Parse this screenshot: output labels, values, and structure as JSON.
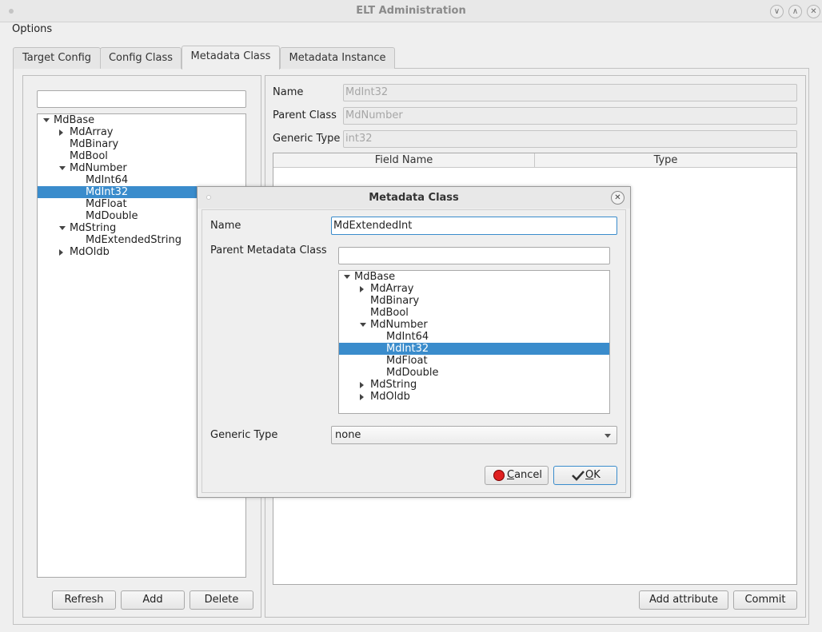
{
  "window": {
    "title": "ELT Administration",
    "controls": {
      "minimize": "∨",
      "maximize": "∧",
      "close": "✕"
    }
  },
  "menu": {
    "items": [
      "Options"
    ]
  },
  "tabs": [
    {
      "label": "Target Config",
      "active": false
    },
    {
      "label": "Config Class",
      "active": false
    },
    {
      "label": "Metadata Class",
      "active": true
    },
    {
      "label": "Metadata Instance",
      "active": false
    }
  ],
  "left_panel": {
    "filter_value": "",
    "tree": [
      {
        "label": "MdBase",
        "level": 0,
        "expander": "open",
        "selected": false
      },
      {
        "label": "MdArray",
        "level": 1,
        "expander": "closed",
        "selected": false
      },
      {
        "label": "MdBinary",
        "level": 1,
        "expander": "none",
        "selected": false
      },
      {
        "label": "MdBool",
        "level": 1,
        "expander": "none",
        "selected": false
      },
      {
        "label": "MdNumber",
        "level": 1,
        "expander": "open",
        "selected": false
      },
      {
        "label": "MdInt64",
        "level": 2,
        "expander": "none",
        "selected": false
      },
      {
        "label": "MdInt32",
        "level": 2,
        "expander": "none",
        "selected": true
      },
      {
        "label": "MdFloat",
        "level": 2,
        "expander": "none",
        "selected": false
      },
      {
        "label": "MdDouble",
        "level": 2,
        "expander": "none",
        "selected": false
      },
      {
        "label": "MdString",
        "level": 1,
        "expander": "open",
        "selected": false
      },
      {
        "label": "MdExtendedString",
        "level": 2,
        "expander": "none",
        "selected": false
      },
      {
        "label": "MdOldb",
        "level": 1,
        "expander": "closed",
        "selected": false
      }
    ],
    "buttons": {
      "refresh": "Refresh",
      "add": "Add",
      "delete": "Delete"
    }
  },
  "right_panel": {
    "name_label": "Name",
    "name_value": "MdInt32",
    "parent_label": "Parent Class",
    "parent_value": "MdNumber",
    "generic_label": "Generic Type",
    "generic_value": "int32",
    "table_columns": [
      "Field Name",
      "Type"
    ],
    "buttons": {
      "add_attribute": "Add attribute",
      "commit": "Commit"
    }
  },
  "dialog": {
    "title": "Metadata Class",
    "name_label": "Name",
    "name_value": "MdExtendedInt",
    "parent_label": "Parent Metadata Class",
    "filter_value": "",
    "tree": [
      {
        "label": "MdBase",
        "level": 0,
        "expander": "open",
        "selected": false
      },
      {
        "label": "MdArray",
        "level": 1,
        "expander": "closed",
        "selected": false
      },
      {
        "label": "MdBinary",
        "level": 1,
        "expander": "none",
        "selected": false
      },
      {
        "label": "MdBool",
        "level": 1,
        "expander": "none",
        "selected": false
      },
      {
        "label": "MdNumber",
        "level": 1,
        "expander": "open",
        "selected": false
      },
      {
        "label": "MdInt64",
        "level": 2,
        "expander": "none",
        "selected": false
      },
      {
        "label": "MdInt32",
        "level": 2,
        "expander": "none",
        "selected": true
      },
      {
        "label": "MdFloat",
        "level": 2,
        "expander": "none",
        "selected": false
      },
      {
        "label": "MdDouble",
        "level": 2,
        "expander": "none",
        "selected": false
      },
      {
        "label": "MdString",
        "level": 1,
        "expander": "closed",
        "selected": false
      },
      {
        "label": "MdOldb",
        "level": 1,
        "expander": "closed",
        "selected": false
      }
    ],
    "generic_label": "Generic Type",
    "generic_value": "none",
    "cancel": {
      "mnemonic": "C",
      "rest": "ancel",
      "icon": "cancel-icon",
      "icon_color": "#e02020"
    },
    "ok": {
      "mnemonic": "O",
      "rest": "K",
      "icon": "checkmark-icon"
    }
  },
  "colors": {
    "selection": "#3a8ccc"
  }
}
